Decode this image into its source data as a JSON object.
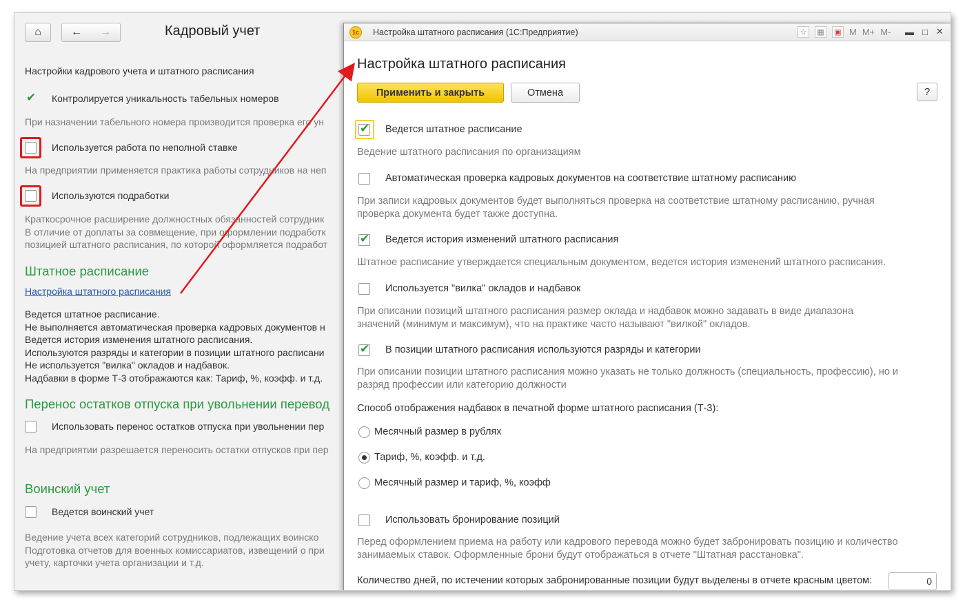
{
  "left": {
    "title": "Кадровый учет",
    "nav": {
      "home": "⌂",
      "back": "←",
      "forward": "→"
    },
    "settings_label": "Настройки кадрового учета и штатного расписания",
    "cb_unique": "Контролируется уникальность табельных номеров",
    "hint_unique": "При назначении табельного номера производится проверка его ун",
    "cb_parttime": "Используется работа по неполной ставке",
    "hint_parttime": "На предприятии применяется практика работы сотрудников на неп",
    "cb_side": "Используются подработки",
    "hint_side": [
      "Краткосрочное расширение должностных обязанностей сотрудник",
      "В отличие от доплаты за совмещение, при оформлении подработк",
      "позицией штатного расписания, по которой оформляется подработ"
    ],
    "section_staff": "Штатное расписание",
    "link_staff": "Настройка штатного расписания",
    "summary": [
      "Ведется штатное расписание.",
      "Не выполняется автоматическая проверка кадровых документов н",
      "Ведется история изменения штатного расписания.",
      "Используются разряды и категории в позиции штатного расписани",
      "Не используется \"вилка\" окладов и надбавок.",
      "Надбавки в форме Т-3 отображаются как: Тариф, %, коэфф. и т.д."
    ],
    "section_vac": "Перенос остатков отпуска при увольнении перевод",
    "cb_vac": "Использовать перенос остатков отпуска при увольнении пер",
    "hint_vac": "На предприятии разрешается переносить остатки отпусков при пер",
    "section_mil": "Воинский учет",
    "cb_mil": "Ведется воинский учет",
    "hint_mil": [
      "Ведение учета всех категорий сотрудников, подлежащих воинско",
      "Подготовка отчетов для военных комиссариатов, извещений о при",
      "учету, карточки учета организации и т.д."
    ]
  },
  "dialog": {
    "window_title": "Настройка штатного расписания  (1С:Предприятие)",
    "logo_text": "1с",
    "toolbar": [
      "M",
      "M+",
      "M-"
    ],
    "heading": "Настройка штатного расписания",
    "apply_label": "Применить и закрыть",
    "cancel_label": "Отмена",
    "help_label": "?",
    "cb1": "Ведется штатное расписание",
    "hint1": "Ведение штатного расписания по организациям",
    "cb2": "Автоматическая проверка кадровых документов на соответствие штатному расписанию",
    "hint2": [
      "При записи кадровых документов будет выполняться проверка на соответствие штатному расписанию, ручная",
      "проверка документа будет также доступна."
    ],
    "cb3": "Ведется история изменений штатного расписания",
    "hint3": "Штатное расписание утверждается специальным документом, ведется история изменений штатного расписания.",
    "cb4": "Используется \"вилка\" окладов и надбавок",
    "hint4": [
      "При описании позиций штатного расписания размер оклада и надбавок можно задавать в виде диапазона",
      "значений (минимум и максимум), что на практике часто называют \"вилкой\" окладов."
    ],
    "cb5": "В позиции штатного расписания используются разряды и категории",
    "hint5": [
      "При описании позиции штатного расписания можно указать не только должность (специальность, профессию), но и",
      "разряд профессии или категорию должности"
    ],
    "display_label": "Способ отображения надбавок в печатной форме штатного расписания (Т-3):",
    "radio1": "Месячный размер в рублях",
    "radio2": "Тариф, %, коэфф. и т.д.",
    "radio3": "Месячный размер и тариф, %, коэфф",
    "cb6": "Использовать бронирование позиций",
    "hint6": [
      "Перед оформлением приема на работу или кадрового перевода можно будет забронировать позицию и количество",
      "занимаемых ставок. Оформленные брони будут отображаться в отчете \"Штатная расстановка\"."
    ],
    "days_label": "Количество дней, по истечении которых забронированные позиции будут выделены в отчете красным цветом:",
    "days_value": "0"
  },
  "colors": {
    "accent": "#2a9a3e",
    "link": "#2456b5",
    "annotation": "#e01b1b",
    "primary_button": "#f1c400"
  },
  "icons": [
    "home-icon",
    "back-arrow-icon",
    "forward-arrow-icon",
    "favorite-icon",
    "calculator-icon",
    "calendar-icon",
    "minimize-icon",
    "maximize-icon",
    "close-icon"
  ]
}
